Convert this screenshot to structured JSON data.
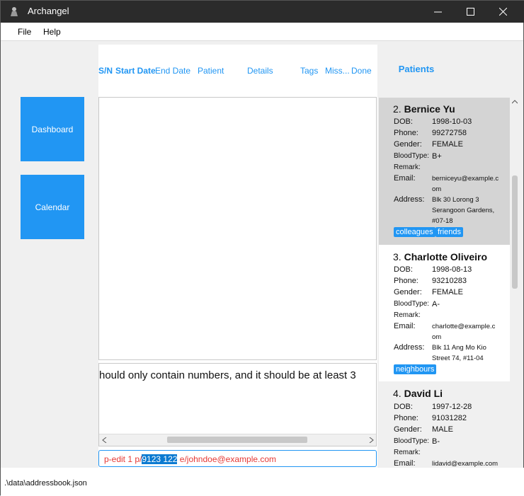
{
  "window": {
    "title": "Archangel"
  },
  "menu": {
    "file": "File",
    "help": "Help"
  },
  "nav": {
    "dashboard": "Dashboard",
    "calendar": "Calendar"
  },
  "table": {
    "columns": [
      "S/N",
      "Start Date",
      "End Date",
      "Patient",
      "Details",
      "Tags",
      "Miss...",
      "Done"
    ]
  },
  "result": {
    "text": "hould only contain numbers, and it should be at least 3"
  },
  "command": {
    "before": "p-edit 1 p/",
    "selected": "9123 122",
    "after": " e/johndoe@example.com"
  },
  "patients": {
    "title": "Patients",
    "labels": {
      "dob": "DOB:",
      "phone": "Phone:",
      "gender": "Gender:",
      "blood": "BloodType:",
      "remark": "Remark:",
      "email": "Email:",
      "address": "Address:"
    },
    "cards": [
      {
        "index": "2.",
        "name": "Bernice Yu",
        "dob": "1998-10-03",
        "phone": "99272758",
        "gender": "FEMALE",
        "blood": "B+",
        "remark": "",
        "email1": "berniceyu@example.c",
        "email2": "om",
        "address1": "Blk 30 Lorong 3",
        "address2": "Serangoon Gardens,",
        "address3": "#07-18",
        "tags": [
          "colleagues",
          "friends"
        ]
      },
      {
        "index": "3.",
        "name": "Charlotte Oliveiro",
        "dob": "1998-08-13",
        "phone": "93210283",
        "gender": "FEMALE",
        "blood": "A-",
        "remark": "",
        "email1": "charlotte@example.c",
        "email2": "om",
        "address1": "Blk 11 Ang Mo Kio",
        "address2": "Street 74, #11-04",
        "tags": [
          "neighbours"
        ]
      },
      {
        "index": "4.",
        "name": "David Li",
        "dob": "1997-12-28",
        "phone": "91031282",
        "gender": "MALE",
        "blood": "B-",
        "remark": "",
        "email1": "lidavid@example.com"
      }
    ]
  },
  "status": {
    "path": ".\\data\\addressbook.json"
  },
  "colors": {
    "accent": "#2196f3",
    "selected_card": "#d4d4d4",
    "titlebar": "#2b2b2b"
  }
}
